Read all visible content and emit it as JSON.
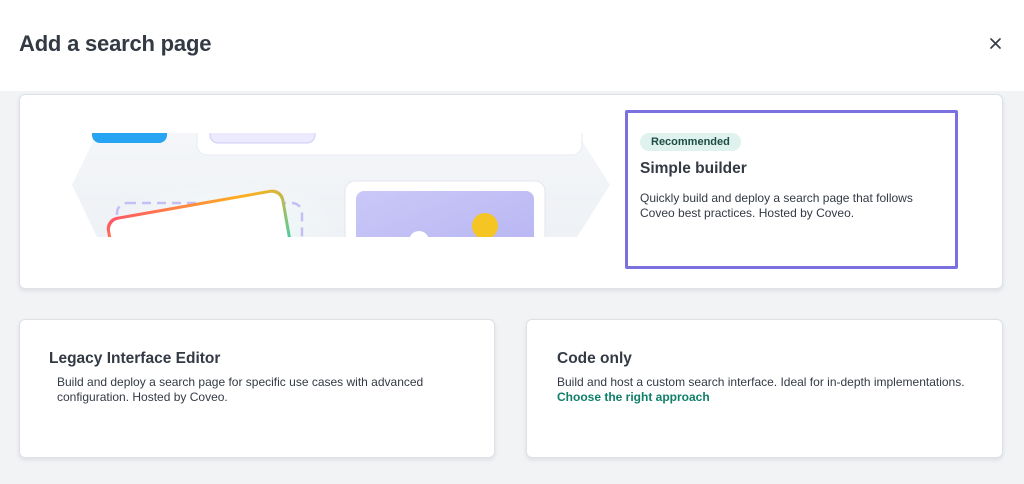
{
  "header": {
    "title": "Add a search page",
    "close_icon": "close-icon"
  },
  "options": {
    "simple_builder": {
      "badge": "Recommended",
      "title": "Simple builder",
      "description": "Quickly build and deploy a search page that follows Coveo best practices. Hosted by Coveo.",
      "selected": true,
      "illustration": "search-page-illustration"
    },
    "legacy": {
      "title": "Legacy Interface Editor",
      "description": "Build and deploy a search page for specific use cases with advanced configuration. Hosted by Coveo."
    },
    "code_only": {
      "title": "Code only",
      "description": "Build and host a custom search interface. Ideal for in-depth implementations.",
      "link": "Choose the right approach"
    }
  },
  "colors": {
    "selection_border": "#7b70e0",
    "badge_bg": "#dff2ee",
    "link": "#0e7f68"
  }
}
